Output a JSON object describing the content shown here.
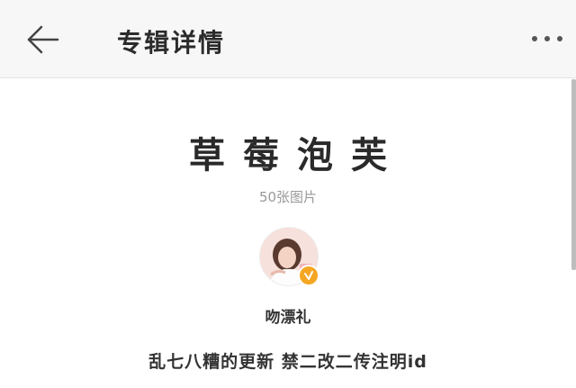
{
  "header": {
    "title": "专辑详情",
    "back_icon": "back-arrow-icon",
    "more_icon": "more-dots-icon"
  },
  "album": {
    "title": "草莓泡芙",
    "photo_count": "50张图片",
    "author_name": "吻漂礼",
    "verified_icon": "verified-badge-icon",
    "description": "乱七八糟的更新 禁二改二传注明id"
  },
  "colors": {
    "header_bg": "#f7f7f7",
    "verified": "#f5a623",
    "muted_text": "#999999"
  }
}
